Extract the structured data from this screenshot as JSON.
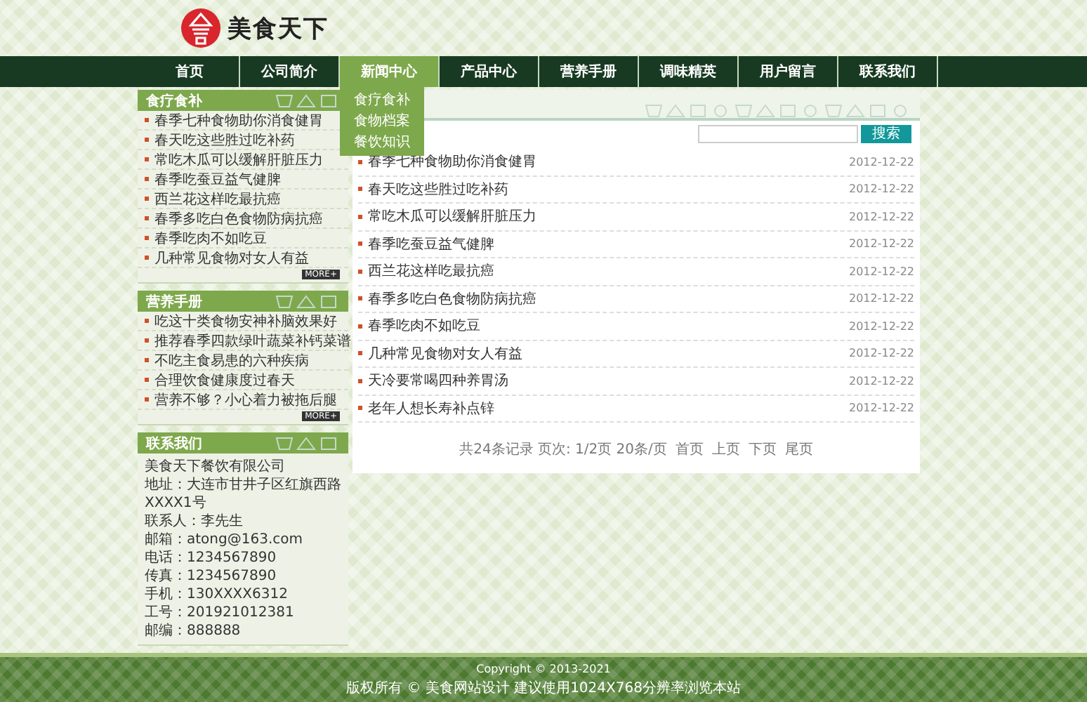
{
  "logo": {
    "text": "美食天下"
  },
  "nav": [
    {
      "label": "首页",
      "selected": false
    },
    {
      "label": "公司简介",
      "selected": false
    },
    {
      "label": "新闻中心",
      "selected": true,
      "dropdown": [
        "食疗食补",
        "食物档案",
        "餐饮知识"
      ]
    },
    {
      "label": "产品中心",
      "selected": false
    },
    {
      "label": "营养手册",
      "selected": false
    },
    {
      "label": "调味精英",
      "selected": false
    },
    {
      "label": "用户留言",
      "selected": false
    },
    {
      "label": "联系我们",
      "selected": false
    }
  ],
  "sidebar": {
    "sections": [
      {
        "title": "食疗食补",
        "items": [
          "春季七种食物助你消食健胃",
          "春天吃这些胜过吃补药",
          "常吃木瓜可以缓解肝脏压力",
          "春季吃蚕豆益气健脾",
          "西兰花这样吃最抗癌",
          "春季多吃白色食物防病抗癌",
          "春季吃肉不如吃豆",
          "几种常见食物对女人有益"
        ],
        "more": "MORE+"
      },
      {
        "title": "营养手册",
        "items": [
          "吃这十类食物安神补脑效果好",
          "推荐春季四款绿叶蔬菜补钙菜谱",
          "不吃主食易患的六种疾病",
          "合理饮食健康度过春天",
          "营养不够？小心着力被拖后腿"
        ],
        "more": "MORE+"
      }
    ],
    "contact": {
      "title": "联系我们",
      "lines": [
        "美食天下餐饮有限公司",
        "地址：大连市甘井子区红旗西路XXXX1号",
        "联系人：李先生",
        "邮箱：atong@163.com",
        "电话：1234567890",
        "传真：1234567890",
        "手机：130XXXX6312",
        "工号：201921012381",
        "邮编：888888"
      ]
    }
  },
  "search": {
    "button": "搜索"
  },
  "articles": [
    {
      "title": "春季七种食物助你消食健胃",
      "date": "2012-12-22"
    },
    {
      "title": "春天吃这些胜过吃补药",
      "date": "2012-12-22"
    },
    {
      "title": "常吃木瓜可以缓解肝脏压力",
      "date": "2012-12-22"
    },
    {
      "title": "春季吃蚕豆益气健脾",
      "date": "2012-12-22"
    },
    {
      "title": "西兰花这样吃最抗癌",
      "date": "2012-12-22"
    },
    {
      "title": "春季多吃白色食物防病抗癌",
      "date": "2012-12-22"
    },
    {
      "title": "春季吃肉不如吃豆",
      "date": "2012-12-22"
    },
    {
      "title": "几种常见食物对女人有益",
      "date": "2012-12-22"
    },
    {
      "title": "天冷要常喝四种养胃汤",
      "date": "2012-12-22"
    },
    {
      "title": "老年人想长寿补点锌",
      "date": "2012-12-22"
    }
  ],
  "pagination": {
    "summary": "共24条记录 页次: 1/2页 20条/页",
    "links": [
      "首页",
      "上页",
      "下页",
      "尾页"
    ]
  },
  "footer": {
    "copyright": "Copyright © 2013-2021",
    "note": "版权所有 © 美食网站设计 建议使用1024X768分辨率浏览本站"
  }
}
